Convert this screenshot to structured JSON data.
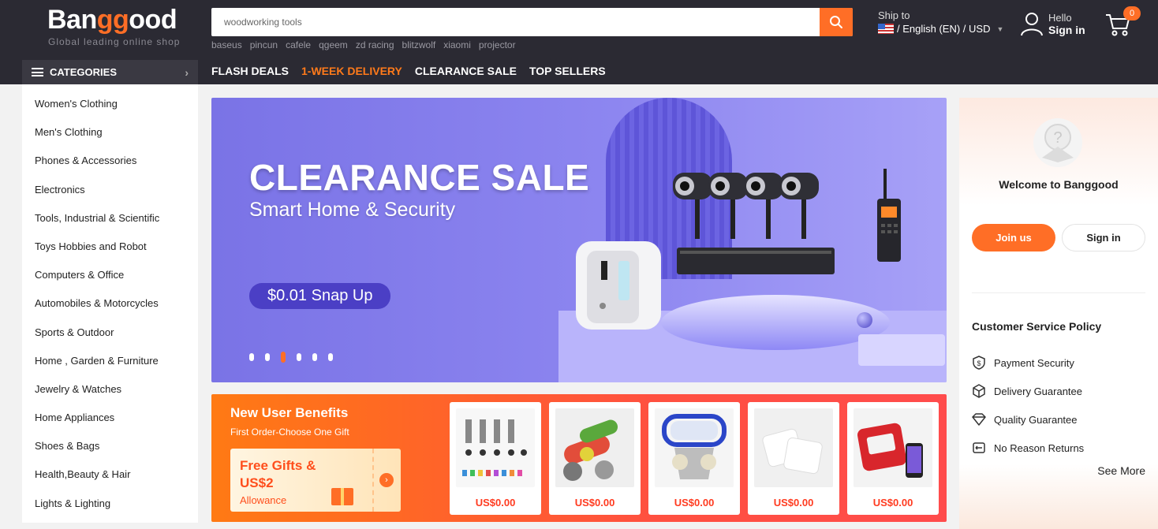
{
  "header": {
    "logo_prefix": "Ban",
    "logo_accent": "gg",
    "logo_suffix": "ood",
    "tagline": "Global leading online shop",
    "search_value": "woodworking tools",
    "hot_words": [
      "baseus",
      "pincun",
      "cafele",
      "qgeem",
      "zd racing",
      "blitzwolf",
      "xiaomi",
      "projector"
    ],
    "ship_to_label": "Ship to",
    "ship_to_value": "/ English (EN) / USD",
    "hello_label": "Hello",
    "sign_in_label": "Sign in",
    "cart_count": "0"
  },
  "nav": {
    "categories_label": "CATEGORIES",
    "links": [
      {
        "label": "FLASH DEALS",
        "accent": false
      },
      {
        "label": "1-WEEK DELIVERY",
        "accent": true
      },
      {
        "label": "CLEARANCE SALE",
        "accent": false
      },
      {
        "label": "TOP SELLERS",
        "accent": false
      }
    ]
  },
  "categories": [
    "Women's Clothing",
    "Men's Clothing",
    "Phones & Accessories",
    "Electronics",
    "Tools, Industrial & Scientific",
    "Toys Hobbies and Robot",
    "Computers & Office",
    "Automobiles & Motorcycles",
    "Sports & Outdoor",
    "Home , Garden & Furniture",
    "Jewelry & Watches",
    "Home Appliances",
    "Shoes & Bags",
    "Health,Beauty & Hair",
    "Lights & Lighting"
  ],
  "banner": {
    "title": "CLEARANCE SALE",
    "subtitle": "Smart Home & Security",
    "cta": "$0.01 Snap Up",
    "slide_count": 6,
    "active_slide": 3
  },
  "account_panel": {
    "welcome": "Welcome to Banggood",
    "join_label": "Join us",
    "sign_in_label": "Sign in",
    "policy_title": "Customer Service Policy",
    "policies": [
      {
        "icon": "dollar-shield-icon",
        "label": "Payment Security"
      },
      {
        "icon": "box-icon",
        "label": "Delivery Guarantee"
      },
      {
        "icon": "diamond-icon",
        "label": "Quality Guarantee"
      },
      {
        "icon": "return-icon",
        "label": "No Reason Returns"
      }
    ],
    "see_more": "See More"
  },
  "new_user": {
    "title": "New User Benefits",
    "subtitle": "First Order-Choose One Gift",
    "coupon_line1": "Free Gifts &",
    "coupon_line2": "US$2",
    "coupon_line3": "Allowance",
    "products": [
      {
        "name": "clips-product-image",
        "price": "US$0.00"
      },
      {
        "name": "keychain-product-image",
        "price": "US$0.00"
      },
      {
        "name": "respirator-mask-product-image",
        "price": "US$0.00"
      },
      {
        "name": "filter-pads-product-image",
        "price": "US$0.00"
      },
      {
        "name": "smart-device-product-image",
        "price": "US$0.00"
      }
    ]
  },
  "colors": {
    "accent": "#ff6e26",
    "header_bg": "#2b2a33",
    "banner_purple": "#8d86f0"
  }
}
